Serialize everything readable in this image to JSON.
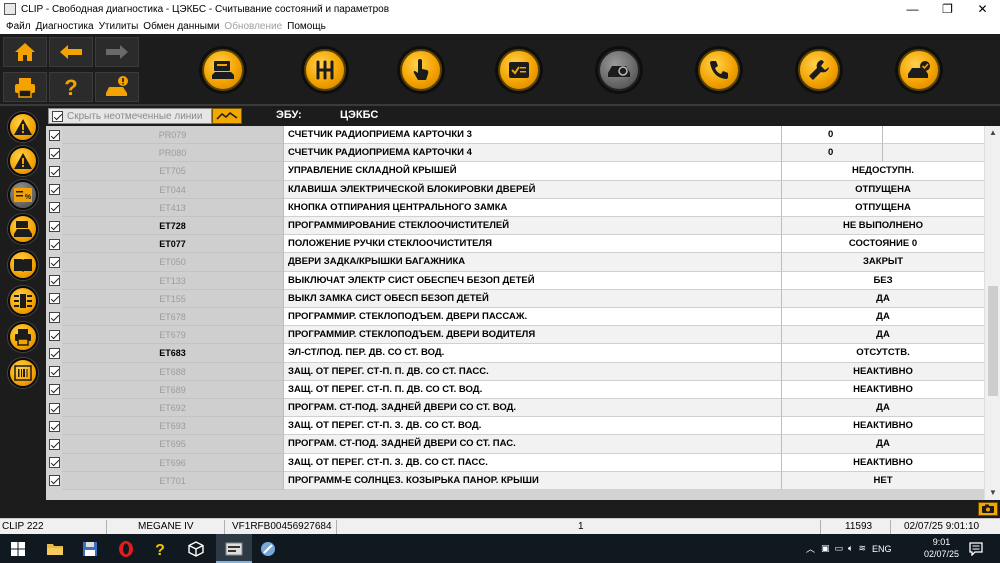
{
  "window": {
    "title": "CLIP - Свободная диагностика - ЦЭКБС - Считывание состояний и параметров",
    "minimize": "—",
    "restore": "❐",
    "close": "✕"
  },
  "menu": {
    "items": [
      "Файл",
      "Диагностика",
      "Утилиты",
      "Обмен данными"
    ],
    "disabled_item": "Обновление",
    "last_item": "Помощь"
  },
  "header": {
    "hide_lines_label": "Скрыть неотмеченные линии",
    "hide_lines_checked": true,
    "ecu_label": "ЭБУ:",
    "ecu_value": "ЦЭКБС"
  },
  "table": {
    "rows": [
      {
        "code": "PR079",
        "name": "СЧЕТЧИК РАДИОПРИЕМА КАРТОЧКИ  3",
        "value": "0",
        "active": false,
        "split": true
      },
      {
        "code": "PR080",
        "name": "СЧЕТЧИК РАДИОПРИЕМА КАРТОЧКИ  4",
        "value": "0",
        "active": false,
        "split": true
      },
      {
        "code": "ET705",
        "name": "УПРАВЛЕНИЕ СКЛАДНОЙ КРЫШЕЙ",
        "value": "НЕДОСТУПН.",
        "active": false,
        "split": false
      },
      {
        "code": "ET044",
        "name": "КЛАВИША ЭЛЕКТРИЧЕСКОЙ БЛОКИРОВКИ ДВЕРЕЙ",
        "value": "ОТПУЩЕНА",
        "active": false,
        "split": false
      },
      {
        "code": "ET413",
        "name": "КНОПКА ОТПИРАНИЯ ЦЕНТРАЛЬНОГО ЗАМКА",
        "value": "ОТПУЩЕНА",
        "active": false,
        "split": false
      },
      {
        "code": "ET728",
        "name": "ПРОГРАММИРОВАНИЕ СТЕКЛООЧИСТИТЕЛЕЙ",
        "value": "НЕ ВЫПОЛНЕНО",
        "active": true,
        "split": false
      },
      {
        "code": "ET077",
        "name": "ПОЛОЖЕНИЕ РУЧКИ СТЕКЛООЧИСТИТЕЛЯ",
        "value": "СОСТОЯНИЕ 0",
        "active": true,
        "split": false
      },
      {
        "code": "ET050",
        "name": "ДВЕРИ ЗАДКА/КРЫШКИ БАГАЖНИКА",
        "value": "ЗАКРЫТ",
        "active": false,
        "split": false
      },
      {
        "code": "ET133",
        "name": "ВЫКЛЮЧАТ ЭЛЕКТР СИСТ ОБЕСПЕЧ БЕЗОП ДЕТЕЙ",
        "value": "БЕЗ",
        "active": false,
        "split": false
      },
      {
        "code": "ET155",
        "name": "ВЫКЛ ЗАМКА СИСТ ОБЕСП БЕЗОП ДЕТЕЙ",
        "value": "ДА",
        "active": false,
        "split": false
      },
      {
        "code": "ET678",
        "name": "ПРОГРАММИР. СТЕКЛОПОДЪЕМ. ДВЕРИ ПАССАЖ.",
        "value": "ДА",
        "active": false,
        "split": false
      },
      {
        "code": "ET679",
        "name": "ПРОГРАММИР. СТЕКЛОПОДЪЕМ. ДВЕРИ ВОДИТЕЛЯ",
        "value": "ДА",
        "active": false,
        "split": false
      },
      {
        "code": "ET683",
        "name": "ЭЛ-СТ/ПОД. ПЕР. ДВ. СО СТ. ВОД.",
        "value": "ОТСУТСТВ.",
        "active": true,
        "split": false
      },
      {
        "code": "ET688",
        "name": "ЗАЩ. ОТ ПЕРЕГ. СТ-П. П. ДВ. СО СТ. ПАСС.",
        "value": "НЕАКТИВНО",
        "active": false,
        "split": false
      },
      {
        "code": "ET689",
        "name": "ЗАЩ. ОТ ПЕРЕГ. СТ-П. П. ДВ. СО СТ. ВОД.",
        "value": "НЕАКТИВНО",
        "active": false,
        "split": false
      },
      {
        "code": "ET692",
        "name": "ПРОГРАМ. СТ-ПОД. ЗАДНЕЙ ДВЕРИ СО СТ. ВОД.",
        "value": "ДА",
        "active": false,
        "split": false
      },
      {
        "code": "ET693",
        "name": "ЗАЩ. ОТ ПЕРЕГ. СТ-П. З. ДВ. СО СТ. ВОД.",
        "value": "НЕАКТИВНО",
        "active": false,
        "split": false
      },
      {
        "code": "ET695",
        "name": "ПРОГРАМ. СТ-ПОД. ЗАДНЕЙ ДВЕРИ СО СТ. ПАС.",
        "value": "ДА",
        "active": false,
        "split": false
      },
      {
        "code": "ET696",
        "name": "ЗАЩ. ОТ ПЕРЕГ. СТ-П. З. ДВ. СО СТ. ПАСС.",
        "value": "НЕАКТИВНО",
        "active": false,
        "split": false
      },
      {
        "code": "ET701",
        "name": "ПРОГРАММ-Е СОЛНЦЕЗ. КОЗЫРЬКА ПАНОР. КРЫШИ",
        "value": "НЕТ",
        "active": false,
        "split": false
      }
    ]
  },
  "status": {
    "tool": "CLIP 222",
    "vehicle": "MEGANE IV",
    "vin": "VF1RFB00456927684",
    "page": "1",
    "code": "11593",
    "datetime": "02/07/25 9:01:10"
  },
  "taskbar": {
    "language": "ENG",
    "time": "9:01",
    "date": "02/07/25"
  },
  "colors": {
    "accent": "#f3a200",
    "toolbar_bg": "#1c1c1c"
  },
  "icons": {
    "toolbar": [
      "home-icon",
      "back-arrow-icon",
      "forward-arrow-icon",
      "print-icon",
      "help-icon",
      "vehicle-alert-icon",
      "ecu-screen-icon",
      "gearbox-icon",
      "touch-icon",
      "checklist-icon",
      "vehicle-diagnosis-icon",
      "phone-support-icon",
      "wrench-icon",
      "vehicle-check-icon"
    ],
    "sidebar": [
      "warning-icon",
      "warning-icon",
      "parameters-icon",
      "vehicle-list-icon",
      "manual-book-icon",
      "injection-icon",
      "printer-vehicle-icon",
      "barcode-icon"
    ]
  }
}
